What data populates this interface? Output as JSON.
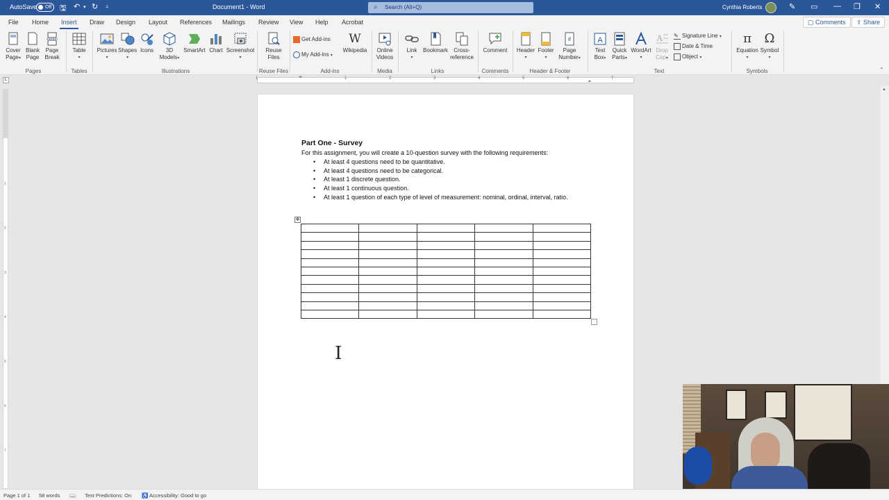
{
  "titlebar": {
    "autosave_label": "AutoSave",
    "autosave_state": "Off",
    "document_title": "Document1 - Word",
    "search_placeholder": "Search (Alt+Q)",
    "user_name": "Cynthia Roberts",
    "accent_color": "#2b579a"
  },
  "tabs": [
    "File",
    "Home",
    "Insert",
    "Draw",
    "Design",
    "Layout",
    "References",
    "Mailings",
    "Review",
    "View",
    "Help",
    "Acrobat"
  ],
  "active_tab": "Insert",
  "comments_button": "Comments",
  "share_button": "Share",
  "ribbon": {
    "pages": {
      "label": "Pages",
      "cover_page_1": "Cover",
      "cover_page_2": "Page",
      "blank_page_1": "Blank",
      "blank_page_2": "Page",
      "page_break_1": "Page",
      "page_break_2": "Break"
    },
    "tables": {
      "label": "Tables",
      "table": "Table"
    },
    "illustrations": {
      "label": "Illustrations",
      "pictures": "Pictures",
      "shapes": "Shapes",
      "icons": "Icons",
      "models_1": "3D",
      "models_2": "Models",
      "smartart": "SmartArt",
      "chart": "Chart",
      "screenshot": "Screenshot"
    },
    "reuse": {
      "label": "Reuse Files",
      "reuse_1": "Reuse",
      "reuse_2": "Files"
    },
    "addins": {
      "label": "Add-ins",
      "get": "Get Add-ins",
      "my": "My Add-ins",
      "wikipedia": "Wikipedia"
    },
    "media": {
      "label": "Media",
      "online_1": "Online",
      "online_2": "Videos"
    },
    "links": {
      "label": "Links",
      "link": "Link",
      "bookmark": "Bookmark",
      "cross_1": "Cross-",
      "cross_2": "reference"
    },
    "comments": {
      "label": "Comments",
      "comment": "Comment"
    },
    "header_footer": {
      "label": "Header & Footer",
      "header": "Header",
      "footer": "Footer",
      "page_number_1": "Page",
      "page_number_2": "Number"
    },
    "text": {
      "label": "Text",
      "textbox_1": "Text",
      "textbox_2": "Box",
      "quickparts_1": "Quick",
      "quickparts_2": "Parts",
      "wordart": "WordArt",
      "dropcap_1": "Drop",
      "dropcap_2": "Cap",
      "signature": "Signature Line",
      "datetime": "Date & Time",
      "object": "Object"
    },
    "symbols": {
      "label": "Symbols",
      "equation": "Equation",
      "symbol": "Symbol"
    }
  },
  "ruler_numbers": [
    "1",
    "1",
    "2",
    "3",
    "4",
    "5",
    "6",
    "7"
  ],
  "vruler_numbers": [
    "1",
    "2",
    "3",
    "4",
    "5",
    "6",
    "7"
  ],
  "document": {
    "heading": "Part One - Survey",
    "intro": "For this assignment, you will create a 10-question survey with the following requirements:",
    "bullets": [
      "At least 4 questions need to be quantitative.",
      "At least 4 questions need to be categorical.",
      "At least 1 discrete question.",
      "At least 1 continuous question.",
      "At least 1 question of each type of level of measurement: nominal, ordinal, interval, ratio."
    ],
    "table_rows": 11,
    "table_cols": 5
  },
  "status": {
    "page": "Page 1 of 1",
    "words": "58 words",
    "predictions": "Text Predictions: On",
    "accessibility": "Accessibility: Good to go"
  }
}
